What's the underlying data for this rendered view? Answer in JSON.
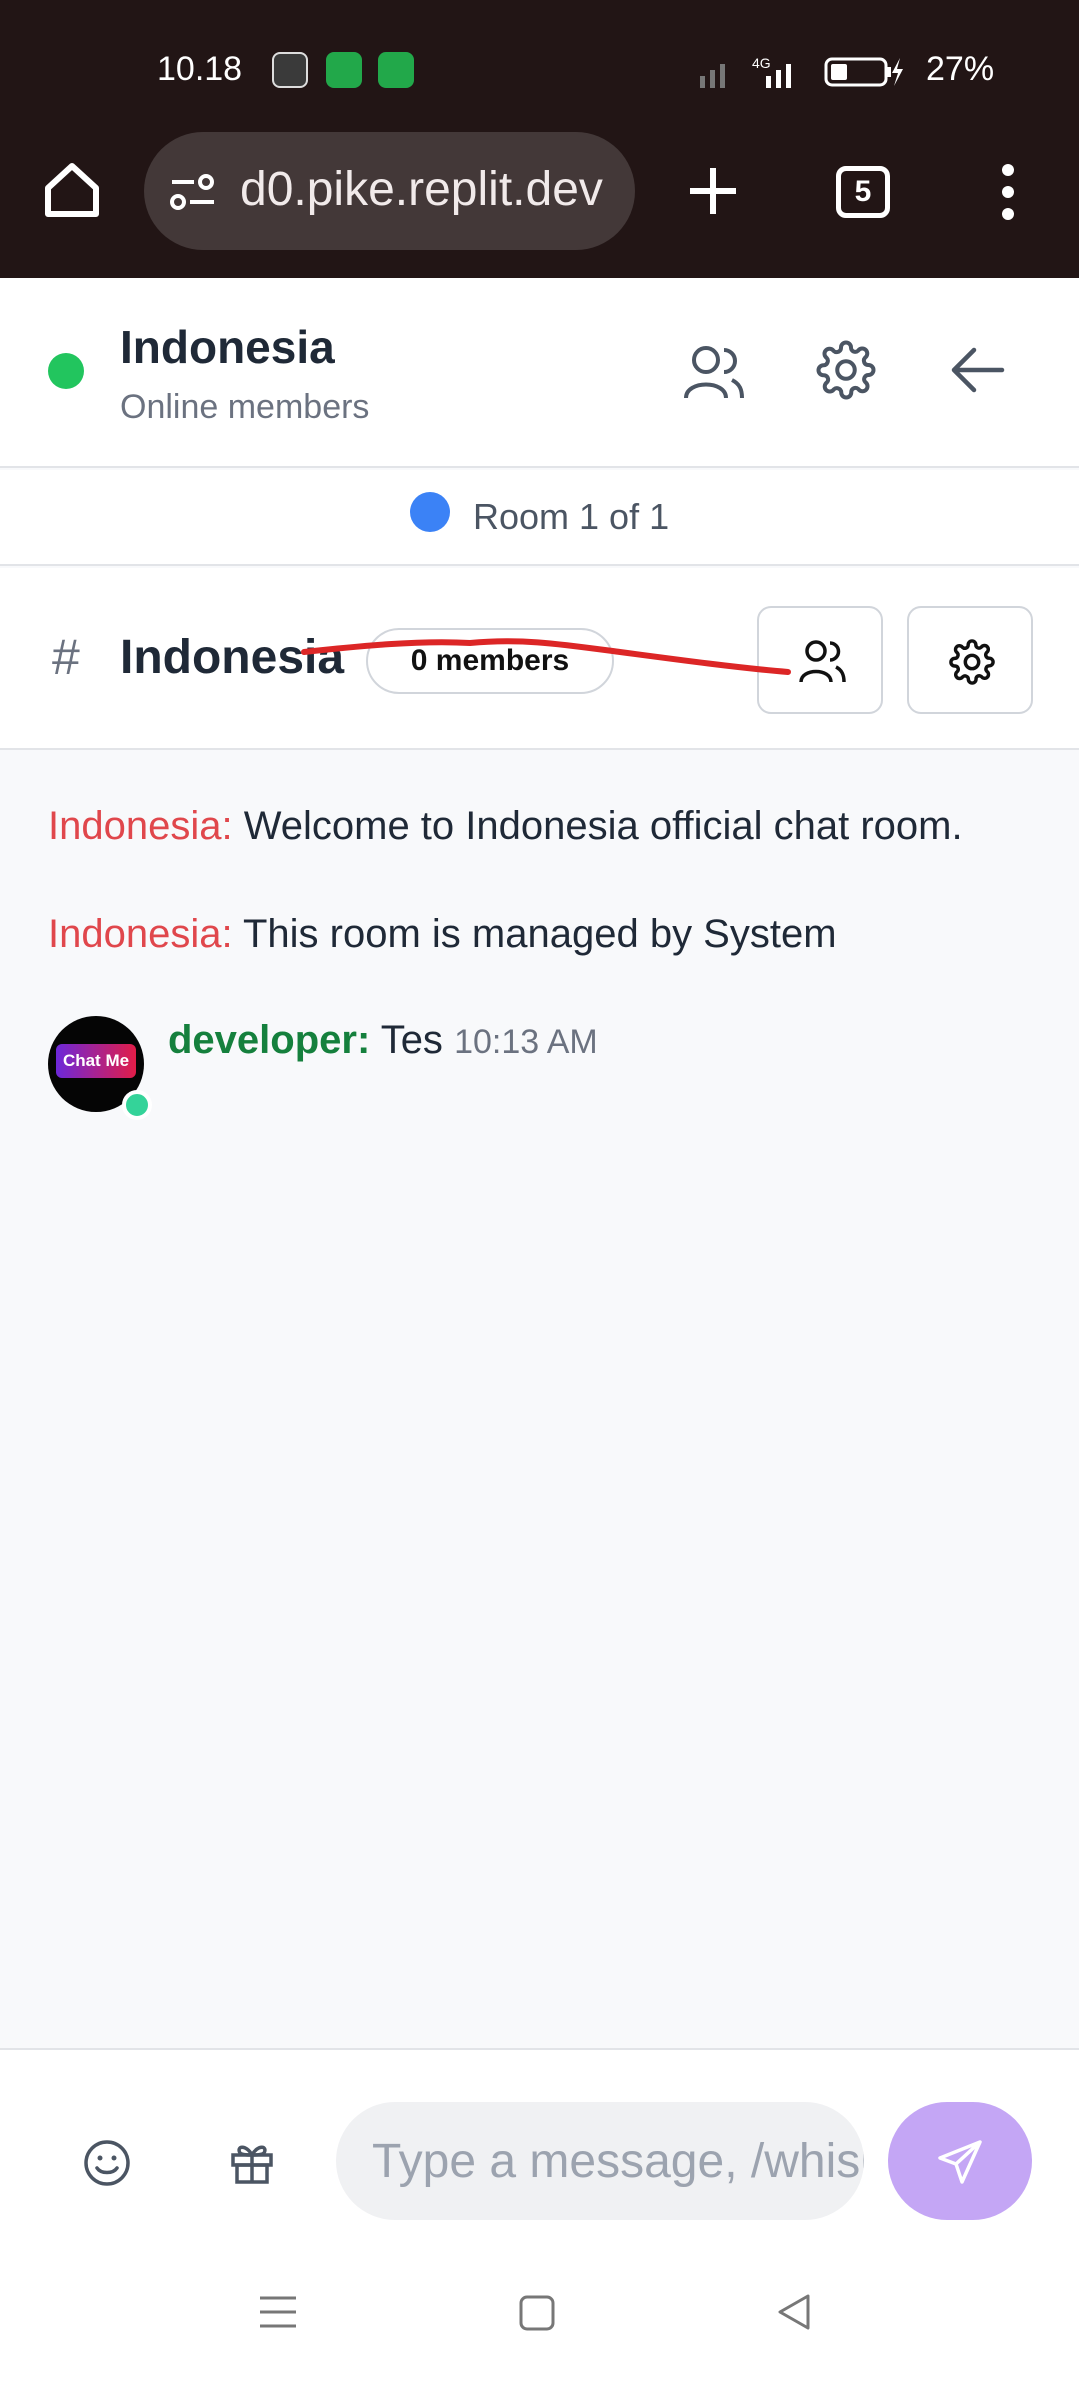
{
  "status_bar": {
    "time": "10.18",
    "battery": "27%",
    "network": "4G"
  },
  "browser": {
    "url": "d0.pike.replit.dev",
    "tab_count": "5"
  },
  "chat_header": {
    "title": "Indonesia",
    "subtitle": "Online members",
    "status_color": "#22c55e"
  },
  "room_bar": {
    "label": "Room 1 of 1"
  },
  "channel": {
    "hash": "#",
    "title": "Indonesia",
    "members": "0 members"
  },
  "messages": [
    {
      "sender": "Indonesia:",
      "text": "Welcome to Indonesia official chat room."
    },
    {
      "sender": "Indonesia:",
      "text": "This room is managed by System"
    },
    {
      "sender": "developer:",
      "text": "Tes",
      "time": "10:13 AM",
      "avatar_text": "Chat Me"
    }
  ],
  "composer": {
    "placeholder": "Type a message, /whisper..."
  },
  "colors": {
    "accent": "#c4a6f5",
    "system_sender": "#e0474c",
    "user_sender": "#15803d",
    "annotation": "#dc2626"
  }
}
